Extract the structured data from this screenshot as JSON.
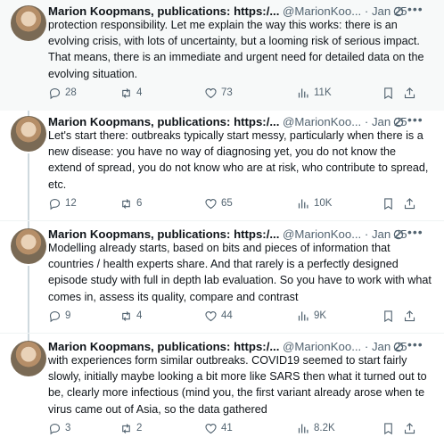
{
  "tweets": [
    {
      "name": "Marion Koopmans, publications: https:/...",
      "handle": "@MarionKoo...",
      "dot": "·",
      "date": "Jan 25",
      "text": "protection responsibility.  Let me explain the way this works: there is an evolving crisis, with lots of uncertainty, but a looming risk of serious impact. That means,  there is an immediate and urgent need for detailed data on the evolving situation.",
      "replies": "28",
      "retweets": "4",
      "likes": "73",
      "views": "11K"
    },
    {
      "name": "Marion Koopmans, publications: https:/...",
      "handle": "@MarionKoo...",
      "dot": "·",
      "date": "Jan 25",
      "text": "Let's start there: outbreaks typically start messy, particularly when there is a new disease: you have no way of diagnosing yet, you do not know the extend of spread, you do not know who are at risk, who contribute to spread, etc.",
      "replies": "12",
      "retweets": "6",
      "likes": "65",
      "views": "10K"
    },
    {
      "name": "Marion Koopmans, publications: https:/...",
      "handle": "@MarionKoo...",
      "dot": "·",
      "date": "Jan 25",
      "text": "Modelling already starts, based on bits and pieces of information that countries / health experts share. And that rarely is a perfectly designed episode study with full in depth lab evaluation. So you have to work with what comes in, assess its quality, compare and contrast",
      "replies": "9",
      "retweets": "4",
      "likes": "44",
      "views": "9K"
    },
    {
      "name": "Marion Koopmans, publications: https:/...",
      "handle": "@MarionKoo...",
      "dot": "·",
      "date": "Jan 25",
      "text": "with experiences form similar outbreaks. COVID19 seemed to start fairly slowly, initially maybe looking a bit more like SARS then what it turned out to be, clearly more infectious (mind you, the first variant already arose when te virus came out of Asia, so the data gathered",
      "replies": "3",
      "retweets": "2",
      "likes": "41",
      "views": "8.2K"
    }
  ],
  "colors": {
    "text": "#0f1419",
    "muted": "#536471",
    "thread": "#cfd9de",
    "highlight_bg": "#f7f9f9"
  },
  "icons": [
    "reply-icon",
    "retweet-icon",
    "like-icon",
    "views-icon",
    "bookmark-icon",
    "share-icon",
    "verified-icon",
    "more-icon"
  ]
}
